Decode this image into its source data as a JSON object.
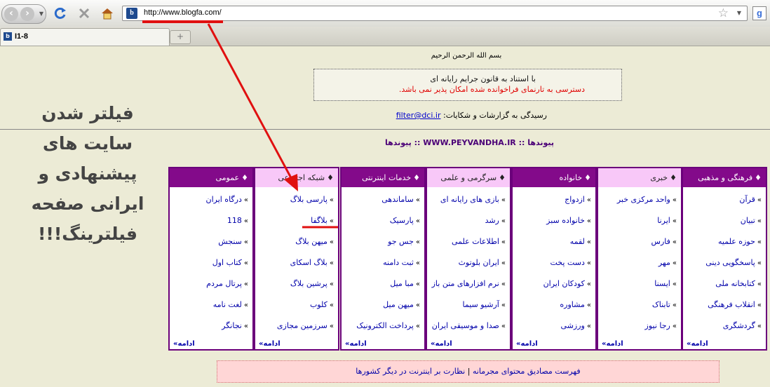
{
  "browser": {
    "url": "http://www.blogfa.com/",
    "tab_title": "I1-8",
    "new_tab": "+"
  },
  "page": {
    "bismillah": "بسم الله الرحمن الرحيم",
    "notice_line1": "با استناد به قانون جرایم رایانه ای",
    "notice_line2": "دسترسی به تارنمای فراخوانده شده امکان پذیر نمی باشد.",
    "report_text": "رسیدگی به گزارشات و شکایات:",
    "report_email": "filter@dci.ir",
    "peyvand_title": "پیوندها :: WWW.PEYVANDHA.IR :: پیوندها",
    "side_annotation": [
      "فیلتر شدن",
      "سایت های",
      "پیشنهادی و",
      "ایرانی صفحه",
      "فیلترینگ!!!"
    ],
    "more_label": "ادامه",
    "arrow": "»",
    "head_marker": "♦",
    "footer_link1": "فهرست مصادیق محتوای مجرمانه",
    "footer_sep": "|",
    "footer_link2": "نظارت بر اینترنت در دیگر کشورها"
  },
  "columns": [
    {
      "title": "فرهنگی و مذهبی",
      "style": "dark",
      "items": [
        "قرآن",
        "تبیان",
        "حوزه علمیه",
        "پاسخگویی دینی",
        "کتابخانه ملی",
        "انقلاب فرهنگی",
        "گردشگری"
      ]
    },
    {
      "title": "خبری",
      "style": "light",
      "items": [
        "واحد مرکزی خبر",
        "ایرنا",
        "فارس",
        "مهر",
        "ایسنا",
        "تابناک",
        "رجا نیوز"
      ]
    },
    {
      "title": "خانواده",
      "style": "dark",
      "items": [
        "ازدواج",
        "خانواده سبز",
        "لقمه",
        "دست پخت",
        "کودکان ایران",
        "مشاوره",
        "ورزشی"
      ]
    },
    {
      "title": "سرگرمی و علمی",
      "style": "light",
      "items": [
        "بازی های رایانه ای",
        "رشد",
        "اطلاعات علمی",
        "ایران بلوتوث",
        "نرم افزارهای متن باز",
        "آرشیو سیما",
        "صدا و موسیقی ایران"
      ]
    },
    {
      "title": "خدمات اینترنتی",
      "style": "dark",
      "items": [
        "ساماندهی",
        "پارسیک",
        "جس جو",
        "ثبت دامنه",
        "مبا میل",
        "میهن میل",
        "پرداخت الکترونیک"
      ]
    },
    {
      "title": "شبکه اجتماعی",
      "style": "light",
      "items": [
        "پارسی بلاگ",
        "بلاگفا",
        "میهن بلاگ",
        "بلاگ اسکای",
        "پرشین بلاگ",
        "کلوب",
        "سرزمین مجازی"
      ]
    },
    {
      "title": "عمومی",
      "style": "dark",
      "items": [
        "درگاه ایران",
        "118",
        "سنجش",
        "کتاب اول",
        "پرتال مردم",
        "لغت نامه",
        "نجانگر"
      ]
    }
  ]
}
